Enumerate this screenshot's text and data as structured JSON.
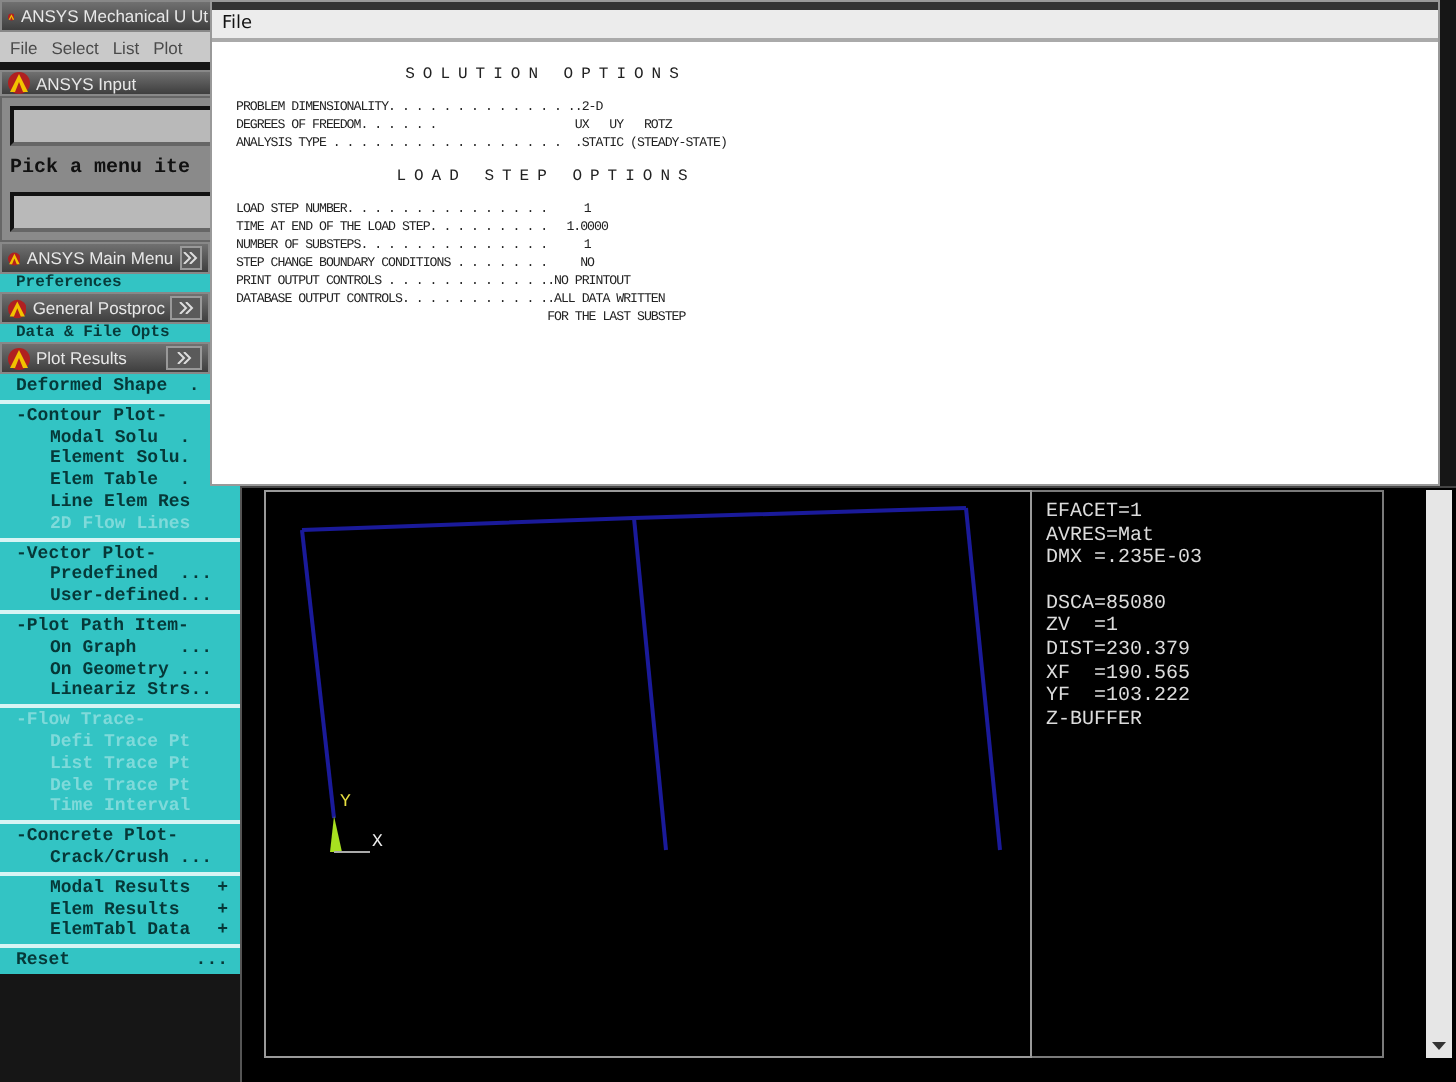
{
  "utility_window": {
    "title": "ANSYS Mechanical U Ut",
    "menu": [
      "File",
      "Select",
      "List",
      "Plot"
    ]
  },
  "input_window": {
    "title": "ANSYS Input",
    "prompt": "Pick a menu ite"
  },
  "main_menu": {
    "title": "ANSYS Main Menu",
    "item": "Preferences"
  },
  "postproc": {
    "title": "General Postproc",
    "item": "Data & File Opts"
  },
  "plot_results": {
    "title": "Plot Results",
    "items": [
      {
        "kind": "header",
        "label": "Deformed Shape  .",
        "disabled": false
      },
      {
        "kind": "separator"
      },
      {
        "kind": "header",
        "label": "-Contour Plot-",
        "disabled": false
      },
      {
        "kind": "item",
        "label": "Modal Solu  .",
        "disabled": false
      },
      {
        "kind": "item",
        "label": "Element Solu.",
        "disabled": false
      },
      {
        "kind": "item",
        "label": "Elem Table  .",
        "disabled": false
      },
      {
        "kind": "item",
        "label": "Line Elem Res",
        "disabled": false
      },
      {
        "kind": "item",
        "label": "2D Flow Lines",
        "disabled": true
      },
      {
        "kind": "separator"
      },
      {
        "kind": "header",
        "label": "-Vector Plot-",
        "disabled": false
      },
      {
        "kind": "item",
        "label": "Predefined  ...",
        "disabled": false
      },
      {
        "kind": "item",
        "label": "User-defined...",
        "disabled": false
      },
      {
        "kind": "separator"
      },
      {
        "kind": "header",
        "label": "-Plot Path Item-",
        "disabled": false
      },
      {
        "kind": "item",
        "label": "On Graph    ...",
        "disabled": false
      },
      {
        "kind": "item",
        "label": "On Geometry ...",
        "disabled": false
      },
      {
        "kind": "item",
        "label": "Lineariz Strs..",
        "disabled": false
      },
      {
        "kind": "separator"
      },
      {
        "kind": "header",
        "label": "-Flow Trace-",
        "disabled": true
      },
      {
        "kind": "item",
        "label": "Defi Trace Pt",
        "disabled": true
      },
      {
        "kind": "item",
        "label": "List Trace Pt",
        "disabled": true
      },
      {
        "kind": "item",
        "label": "Dele Trace Pt",
        "disabled": true
      },
      {
        "kind": "item",
        "label": "Time Interval",
        "disabled": true
      },
      {
        "kind": "separator"
      },
      {
        "kind": "header",
        "label": "-Concrete Plot-",
        "disabled": false
      },
      {
        "kind": "item",
        "label": "Crack/Crush ...",
        "disabled": false
      }
    ]
  },
  "postproc_items": [
    {
      "kind": "item",
      "label": "Modal Results",
      "suffix": "+"
    },
    {
      "kind": "item",
      "label": "Elem Results",
      "suffix": "+"
    },
    {
      "kind": "item",
      "label": "ElemTabl Data",
      "suffix": "+"
    },
    {
      "kind": "separator"
    },
    {
      "kind": "header",
      "label": "Reset",
      "suffix": "..."
    }
  ],
  "output_window": {
    "menu": [
      "File"
    ],
    "sections": [
      {
        "heading": "SOLUTION OPTIONS",
        "rows": [
          {
            "label": "PROBLEM DIMENSIONALITY. . . . . . . . . . . . . .",
            "value": ".2-D",
            "kind": "text"
          },
          {
            "label": "DEGREES OF FREEDOM. . . . . .",
            "value": "UX   UY   ROTZ",
            "kind": "text"
          },
          {
            "label": "ANALYSIS TYPE . . . . . . . . . . . . . . . . .",
            "value": ".STATIC (STEADY-STATE)",
            "kind": "text"
          }
        ]
      },
      {
        "heading": "LOAD STEP OPTIONS",
        "rows": [
          {
            "label": "LOAD STEP NUMBER. . . . . . . . . . . . . . .",
            "value": "1",
            "kind": "number"
          },
          {
            "label": "TIME AT END OF THE LOAD STEP. . . . . . . . .",
            "value": "1.0000",
            "kind": "number"
          },
          {
            "label": "NUMBER OF SUBSTEPS. . . . . . . . . . . . . .",
            "value": "1",
            "kind": "number"
          },
          {
            "label": "STEP CHANGE BOUNDARY CONDITIONS . . . . . . .",
            "value": "NO",
            "kind": "number"
          },
          {
            "label": "PRINT OUTPUT CONTROLS . . . . . . . . . . . .",
            "value": ".NO PRINTOUT",
            "kind": "text"
          },
          {
            "label": "DATABASE OUTPUT CONTROLS. . . . . . . . . . .",
            "value": ".ALL DATA WRITTEN",
            "kind": "text"
          },
          {
            "value": "FOR THE LAST SUBSTEP",
            "kind": "text"
          }
        ]
      }
    ]
  },
  "graphics": {
    "axis_labels": [
      "Y",
      "X"
    ],
    "legend": [
      [
        "EFACET=1",
        "AVRES=Mat",
        "DMX =.235E-03"
      ],
      [
        "DSCA=85080",
        "ZV  =1",
        "DIST=230.379",
        "XF  =190.565",
        "YF  =103.222",
        "Z-BUFFER"
      ]
    ]
  }
}
